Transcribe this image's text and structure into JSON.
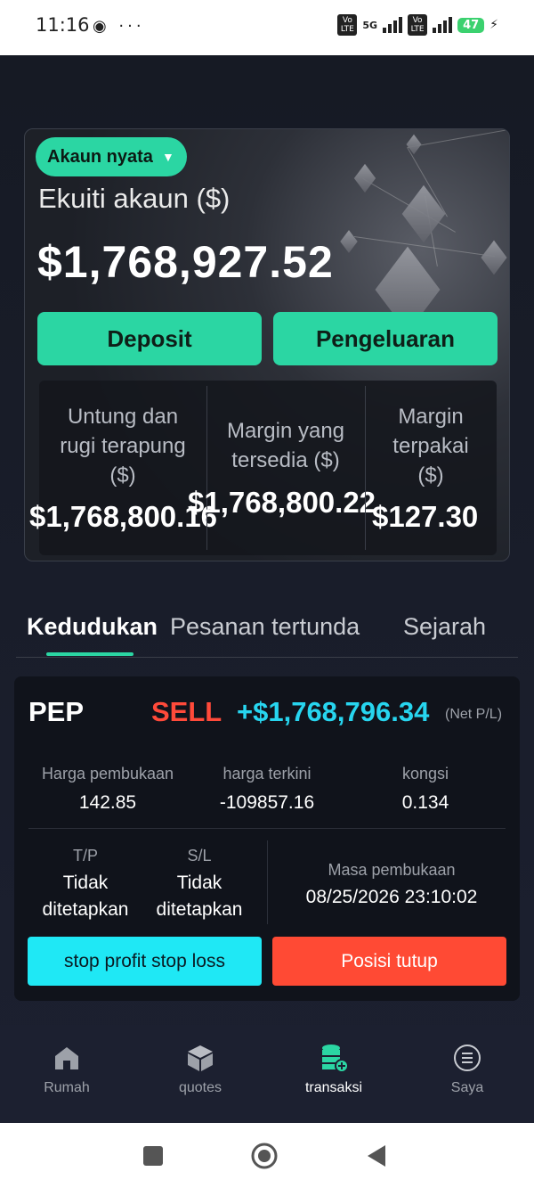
{
  "status_bar": {
    "time": "11:16",
    "left_icons": "◉ ···",
    "volte": "Vo LTE",
    "network": "5G",
    "battery": "47",
    "bolt": "⚡"
  },
  "account": {
    "type_label": "Akaun nyata",
    "equity_label": "Ekuiti akaun ($)",
    "equity_value": "$1,768,927.52",
    "deposit_label": "Deposit",
    "withdraw_label": "Pengeluaran"
  },
  "stats": [
    {
      "label": "Untung dan rugi terapung ($)",
      "value": "$1,768,800.16"
    },
    {
      "label": "Margin yang tersedia ($)",
      "value": "$1,768,800.22"
    },
    {
      "label": "Margin terpakai ($)",
      "value": "$127.30"
    }
  ],
  "tabs": {
    "positions": "Kedudukan",
    "pending": "Pesanan tertunda",
    "history": "Sejarah"
  },
  "position": {
    "symbol": "PEP",
    "side": "SELL",
    "net_pl": "+$1,768,796.34",
    "net_pl_suffix": "(Net P/L)",
    "open_price_label": "Harga pembukaan",
    "open_price": "142.85",
    "current_price_label": "harga terkini",
    "current_price": "-109857.16",
    "share_label": "kongsi",
    "share": "0.134",
    "tp_label": "T/P",
    "tp_value_1": "Tidak",
    "tp_value_2": "ditetapkan",
    "sl_label": "S/L",
    "sl_value_1": "Tidak",
    "sl_value_2": "ditetapkan",
    "open_time_label": "Masa pembukaan",
    "open_time": "08/25/2026 23:10:02",
    "tpsl_button": "stop profit stop loss",
    "close_button": "Posisi tutup"
  },
  "bottom_nav": [
    {
      "label": "Rumah",
      "icon": "home-icon"
    },
    {
      "label": "quotes",
      "icon": "cube-icon"
    },
    {
      "label": "transaksi",
      "icon": "coins-icon"
    },
    {
      "label": "Saya",
      "icon": "menu-icon"
    }
  ],
  "colors": {
    "accent": "#2bd6a3",
    "sell": "#ff4a3a",
    "profit": "#27d5ef",
    "close_button": "#ff4a34",
    "tpsl_button": "#1fe8f5"
  }
}
